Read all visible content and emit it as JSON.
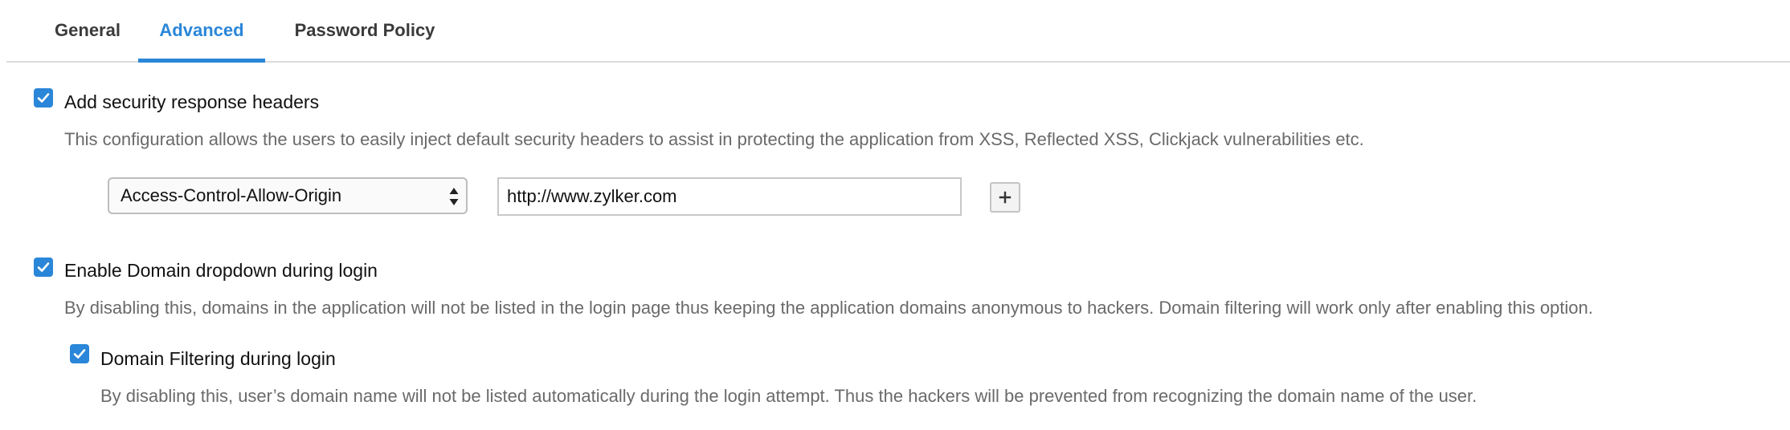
{
  "tabs": [
    {
      "label": "General",
      "active": false
    },
    {
      "label": "Advanced",
      "active": true
    },
    {
      "label": "Password Policy",
      "active": false
    }
  ],
  "security_headers": {
    "checked": true,
    "label": "Add security response headers",
    "description": "This configuration allows the users to easily inject default security headers to assist in protecting the application from XSS, Reflected XSS, Clickjack vulnerabilities etc.",
    "header_select": {
      "value": "Access-Control-Allow-Origin",
      "icon": "sort-arrows-icon"
    },
    "header_value": "http://www.zylker.com",
    "add_button": {
      "label": "+",
      "icon": "plus-icon"
    }
  },
  "domain_dropdown": {
    "checked": true,
    "label": "Enable Domain dropdown during login",
    "description": "By disabling this, domains in the application will not be listed in the login page thus keeping the application domains anonymous to hackers. Domain filtering will work only after enabling this option."
  },
  "domain_filtering": {
    "checked": true,
    "label": "Domain Filtering during login",
    "description": "By disabling this, user’s domain name will not be listed automatically during the login attempt. Thus the hackers will be prevented from recognizing the domain name of the user."
  },
  "colors": {
    "accent": "#2a86d8",
    "tab_text": "#3a3a3a",
    "description_text": "#6a6a6a"
  }
}
